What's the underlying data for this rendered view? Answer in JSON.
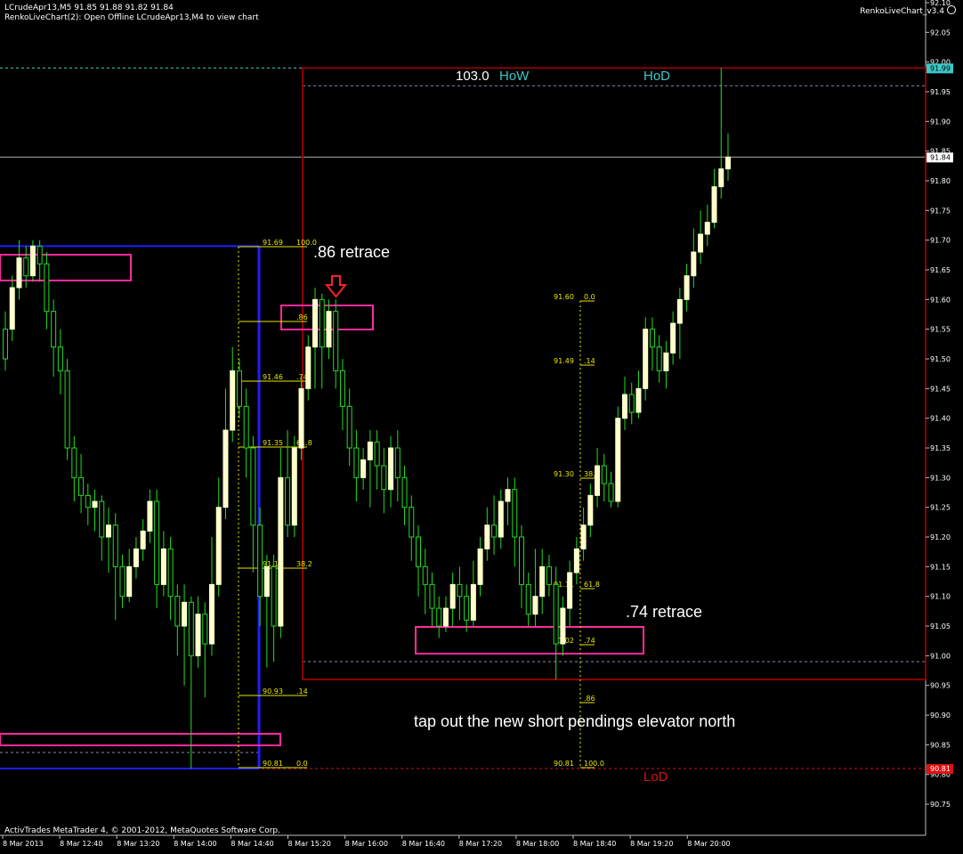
{
  "header": {
    "line1": "LCrudeApr13,M5  91.85 91.88 91.82 91.84",
    "line2": "RenkoLiveChart(2): Open Offline LCrudeApr13,M4 to view chart",
    "indicator": "RenkoLiveChart_v3.4",
    "indicator_icon": "smiley-icon"
  },
  "footer": "ActivTrades MetaTrader 4, © 2001-2012, MetaQuotes Software Corp.",
  "annotations": {
    "retrace_86": ".86 retrace",
    "retrace_74": ".74 retrace",
    "note": "tap out the new short pendings elevator north",
    "how_value": "103.0",
    "how": "HoW",
    "hod": "HoD",
    "lod": "LoD"
  },
  "colors": {
    "background": "#000000",
    "bull_body": "#FFFFCC",
    "wick": "#22DD22",
    "fib": "#E6E600",
    "box_pink": "#FF2A9C",
    "box_dark_red": "#8B0000",
    "blue": "#1E1EFF",
    "cyan": "#3CC8C8",
    "lod_red": "#DD1111"
  },
  "chart_data": {
    "type": "candlestick",
    "symbol": "LCrudeApr13",
    "timeframe": "M5",
    "ylim": [
      90.7,
      92.1
    ],
    "y_ticks": [
      "92.10",
      "92.05",
      "92.00",
      "91.95",
      "91.90",
      "91.85",
      "91.80",
      "91.75",
      "91.70",
      "91.65",
      "91.60",
      "91.55",
      "91.50",
      "91.45",
      "91.40",
      "91.35",
      "91.30",
      "91.25",
      "91.20",
      "91.15",
      "91.10",
      "91.05",
      "91.00",
      "90.95",
      "90.90",
      "90.85",
      "90.80",
      "90.75"
    ],
    "x_ticks": [
      "8 Mar 2013",
      "8 Mar 12:40",
      "8 Mar 13:20",
      "8 Mar 14:00",
      "8 Mar 14:40",
      "8 Mar 15:20",
      "8 Mar 16:00",
      "8 Mar 16:40",
      "8 Mar 17:20",
      "8 Mar 18:00",
      "8 Mar 18:40",
      "8 Mar 19:20",
      "8 Mar 20:00"
    ],
    "price_tags": [
      {
        "label": "91.99",
        "value": 91.99,
        "bg": "#3CC8C8",
        "fg": "#000000"
      },
      {
        "label": "91.84",
        "value": 91.84,
        "bg": "#FFFFFF",
        "fg": "#000000"
      },
      {
        "label": "90.81",
        "value": 90.81,
        "bg": "#DD1111",
        "fg": "#FFFFFF"
      }
    ],
    "fib_left": [
      {
        "price": "91.69",
        "pct": "100.0"
      },
      {
        "price": "",
        "pct": ".86"
      },
      {
        "price": "91.46",
        "pct": ".74"
      },
      {
        "price": "91.35",
        "pct": "61.8"
      },
      {
        "price": "91.15",
        "pct": "38.2"
      },
      {
        "price": "90.93",
        "pct": ".14"
      },
      {
        "price": "90.81",
        "pct": "0.0"
      }
    ],
    "fib_right": [
      {
        "price": "91.60",
        "pct": "0.0"
      },
      {
        "price": "91.49",
        "pct": ".14"
      },
      {
        "price": "91.30",
        "pct": "38.2"
      },
      {
        "price": "91.11",
        "pct": "61.8"
      },
      {
        "price": "91.02",
        "pct": ".74"
      },
      {
        "price": "",
        "pct": ".86"
      },
      {
        "price": "90.81",
        "pct": "100.0"
      }
    ],
    "levels": {
      "hod": 91.99,
      "dash_high": 91.96,
      "current": 91.84,
      "how_box_low": 90.96,
      "dash_low": 90.99,
      "lod": 90.81,
      "blue_top": 91.69,
      "blue_bottom": 90.81
    },
    "candles": [
      [
        91.55,
        91.5,
        91.58,
        91.48
      ],
      [
        91.55,
        91.62,
        91.64,
        91.53
      ],
      [
        91.62,
        91.67,
        91.7,
        91.6
      ],
      [
        91.67,
        91.64,
        91.69,
        91.62
      ],
      [
        91.64,
        91.69,
        91.7,
        91.63
      ],
      [
        91.69,
        91.66,
        91.7,
        91.63
      ],
      [
        91.66,
        91.58,
        91.68,
        91.55
      ],
      [
        91.58,
        91.52,
        91.6,
        91.47
      ],
      [
        91.52,
        91.48,
        91.55,
        91.44
      ],
      [
        91.48,
        91.35,
        91.5,
        91.33
      ],
      [
        91.35,
        91.3,
        91.37,
        91.26
      ],
      [
        91.3,
        91.27,
        91.34,
        91.24
      ],
      [
        91.27,
        91.25,
        91.29,
        91.22
      ],
      [
        91.25,
        91.26,
        91.28,
        91.21
      ],
      [
        91.26,
        91.2,
        91.27,
        91.16
      ],
      [
        91.2,
        91.22,
        91.25,
        91.14
      ],
      [
        91.22,
        91.15,
        91.24,
        91.06
      ],
      [
        91.15,
        91.1,
        91.17,
        91.08
      ],
      [
        91.1,
        91.15,
        91.18,
        91.09
      ],
      [
        91.15,
        91.18,
        91.2,
        91.13
      ],
      [
        91.18,
        91.21,
        91.23,
        91.16
      ],
      [
        91.21,
        91.26,
        91.28,
        91.19
      ],
      [
        91.26,
        91.12,
        91.28,
        91.08
      ],
      [
        91.12,
        91.18,
        91.21,
        91.1
      ],
      [
        91.18,
        91.1,
        91.2,
        91.06
      ],
      [
        91.1,
        91.05,
        91.12,
        91.0
      ],
      [
        91.05,
        91.09,
        91.12,
        90.95
      ],
      [
        91.09,
        91.0,
        91.1,
        90.81
      ],
      [
        91.0,
        91.07,
        91.1,
        90.98
      ],
      [
        91.07,
        91.02,
        91.09,
        90.93
      ],
      [
        91.02,
        91.12,
        91.2,
        91.0
      ],
      [
        91.12,
        91.25,
        91.3,
        91.1
      ],
      [
        91.25,
        91.38,
        91.45,
        91.23
      ],
      [
        91.38,
        91.48,
        91.52,
        91.36
      ],
      [
        91.48,
        91.42,
        91.5,
        91.4
      ],
      [
        91.42,
        91.35,
        91.45,
        91.3
      ],
      [
        91.35,
        91.22,
        91.37,
        91.14
      ],
      [
        91.22,
        91.1,
        91.25,
        91.05
      ],
      [
        91.1,
        91.15,
        91.17,
        90.98
      ],
      [
        91.15,
        91.05,
        91.17,
        90.99
      ],
      [
        91.05,
        91.3,
        91.35,
        91.03
      ],
      [
        91.3,
        91.22,
        91.38,
        91.2
      ],
      [
        91.22,
        91.35,
        91.37,
        91.2
      ],
      [
        91.35,
        91.45,
        91.47,
        91.33
      ],
      [
        91.45,
        91.52,
        91.54,
        91.43
      ],
      [
        91.52,
        91.6,
        91.62,
        91.45
      ],
      [
        91.6,
        91.52,
        91.61,
        91.45
      ],
      [
        91.52,
        91.58,
        91.6,
        91.5
      ],
      [
        91.58,
        91.48,
        91.6,
        91.45
      ],
      [
        91.48,
        91.42,
        91.5,
        91.38
      ],
      [
        91.42,
        91.35,
        91.45,
        91.32
      ],
      [
        91.35,
        91.3,
        91.38,
        91.26
      ],
      [
        91.3,
        91.33,
        91.35,
        91.28
      ],
      [
        91.33,
        91.36,
        91.38,
        91.25
      ],
      [
        91.36,
        91.32,
        91.38,
        91.28
      ],
      [
        91.32,
        91.28,
        91.35,
        91.24
      ],
      [
        91.28,
        91.35,
        91.37,
        91.25
      ],
      [
        91.35,
        91.3,
        91.38,
        91.26
      ],
      [
        91.3,
        91.25,
        91.32,
        91.22
      ],
      [
        91.25,
        91.2,
        91.27,
        91.16
      ],
      [
        91.2,
        91.15,
        91.22,
        91.1
      ],
      [
        91.15,
        91.12,
        91.18,
        91.07
      ],
      [
        91.12,
        91.08,
        91.14,
        91.05
      ],
      [
        91.08,
        91.05,
        91.1,
        91.03
      ],
      [
        91.05,
        91.08,
        91.1,
        91.04
      ],
      [
        91.08,
        91.12,
        91.14,
        91.05
      ],
      [
        91.12,
        91.1,
        91.15,
        91.06
      ],
      [
        91.1,
        91.06,
        91.12,
        91.04
      ],
      [
        91.06,
        91.12,
        91.16,
        91.05
      ],
      [
        91.12,
        91.18,
        91.2,
        91.1
      ],
      [
        91.18,
        91.22,
        91.25,
        91.16
      ],
      [
        91.22,
        91.2,
        91.27,
        91.17
      ],
      [
        91.2,
        91.26,
        91.28,
        91.18
      ],
      [
        91.26,
        91.28,
        91.3,
        91.22
      ],
      [
        91.28,
        91.2,
        91.3,
        91.15
      ],
      [
        91.2,
        91.12,
        91.22,
        91.08
      ],
      [
        91.12,
        91.07,
        91.14,
        91.05
      ],
      [
        91.07,
        91.1,
        91.18,
        91.05
      ],
      [
        91.1,
        91.15,
        91.18,
        91.07
      ],
      [
        91.15,
        91.12,
        91.17,
        91.1
      ],
      [
        91.12,
        91.02,
        91.15,
        90.96
      ],
      [
        91.02,
        91.08,
        91.1,
        91.0
      ],
      [
        91.08,
        91.14,
        91.16,
        91.05
      ],
      [
        91.14,
        91.18,
        91.2,
        91.12
      ],
      [
        91.18,
        91.22,
        91.25,
        91.16
      ],
      [
        91.22,
        91.27,
        91.29,
        91.2
      ],
      [
        91.27,
        91.32,
        91.35,
        91.25
      ],
      [
        91.32,
        91.29,
        91.34,
        91.26
      ],
      [
        91.29,
        91.26,
        91.31,
        91.25
      ],
      [
        91.26,
        91.4,
        91.42,
        91.25
      ],
      [
        91.4,
        91.44,
        91.47,
        91.38
      ],
      [
        91.44,
        91.41,
        91.46,
        91.39
      ],
      [
        91.41,
        91.45,
        91.48,
        91.4
      ],
      [
        91.45,
        91.55,
        91.57,
        91.43
      ],
      [
        91.55,
        91.52,
        91.57,
        91.48
      ],
      [
        91.52,
        91.48,
        91.54,
        91.46
      ],
      [
        91.48,
        91.51,
        91.53,
        91.45
      ],
      [
        91.51,
        91.56,
        91.58,
        91.49
      ],
      [
        91.56,
        91.6,
        91.62,
        91.5
      ],
      [
        91.6,
        91.64,
        91.66,
        91.58
      ],
      [
        91.64,
        91.68,
        91.72,
        91.62
      ],
      [
        91.68,
        91.71,
        91.75,
        91.66
      ],
      [
        91.71,
        91.73,
        91.76,
        91.69
      ],
      [
        91.73,
        91.79,
        91.82,
        91.72
      ],
      [
        91.79,
        91.82,
        91.99,
        91.77
      ],
      [
        91.82,
        91.84,
        91.88,
        91.8
      ]
    ]
  }
}
